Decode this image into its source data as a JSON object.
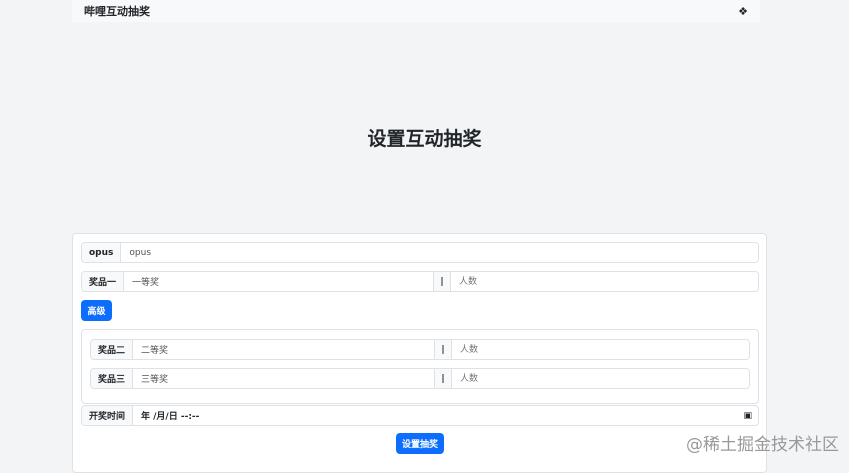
{
  "nav": {
    "brand": "哔哩互动抽奖",
    "icon": "puzzle-icon"
  },
  "title": "设置互动抽奖",
  "form": {
    "opus": {
      "label": "opus",
      "value": "opus"
    },
    "prize1": {
      "label": "奖品一",
      "value": "一等奖",
      "sep": "|",
      "count_placeholder": "人数"
    },
    "advanced_button": "高级",
    "prize2": {
      "label": "奖品二",
      "value": "二等奖",
      "sep": "|",
      "count_placeholder": "人数"
    },
    "prize3": {
      "label": "奖品三",
      "value": "三等奖",
      "sep": "|",
      "count_placeholder": "人数"
    },
    "time": {
      "label": "开奖时间",
      "value": "年 /月/日 --:--"
    },
    "submit_button": "设置抽奖"
  },
  "watermark": "@稀土掘金技术社区"
}
